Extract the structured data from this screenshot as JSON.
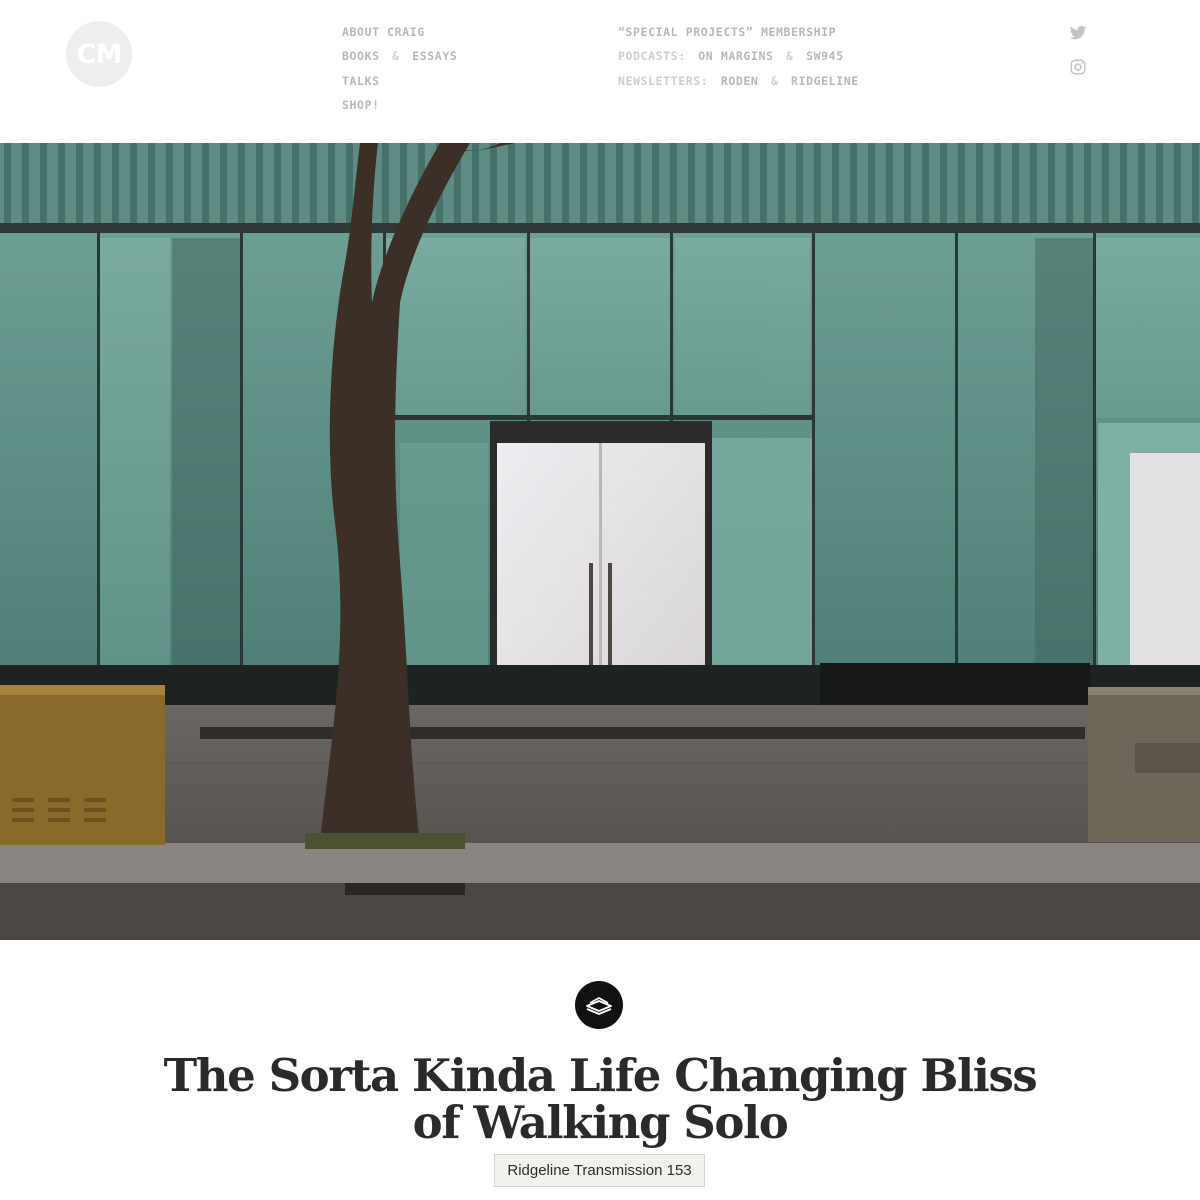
{
  "header": {
    "logo_text": "CM",
    "nav_left": [
      {
        "label": "ABOUT CRAIG"
      },
      {
        "label": "BOOKS",
        "joiner": "&",
        "label2": "ESSAYS"
      },
      {
        "label": "TALKS"
      },
      {
        "label": "SHOP!"
      }
    ],
    "nav_mid": [
      {
        "label": "“SPECIAL PROJECTS” MEMBERSHIP"
      },
      {
        "prefix": "PODCASTS:",
        "label": "ON MARGINS",
        "joiner": "&",
        "label2": "SW945"
      },
      {
        "prefix": "NEWSLETTERS:",
        "label": "RODEN",
        "joiner": "&",
        "label2": "RIDGELINE"
      }
    ],
    "social": [
      {
        "icon": "twitter-icon"
      },
      {
        "icon": "instagram-icon"
      }
    ]
  },
  "hero": {
    "colors": {
      "glass": "#5f8f86",
      "glass_light": "#7fb0a6",
      "door": "#e6e3e6",
      "ground": "#6e6a66",
      "road": "#4f4c49",
      "tree": "#3a2d25",
      "box": "#8a6a2a"
    }
  },
  "article": {
    "section_icon": "stacked-books-icon",
    "title_line1": "The Sorta Kinda Life Changing Bliss",
    "title_line2": "of Walking Solo",
    "series_label": "Ridgeline Transmission 153"
  }
}
